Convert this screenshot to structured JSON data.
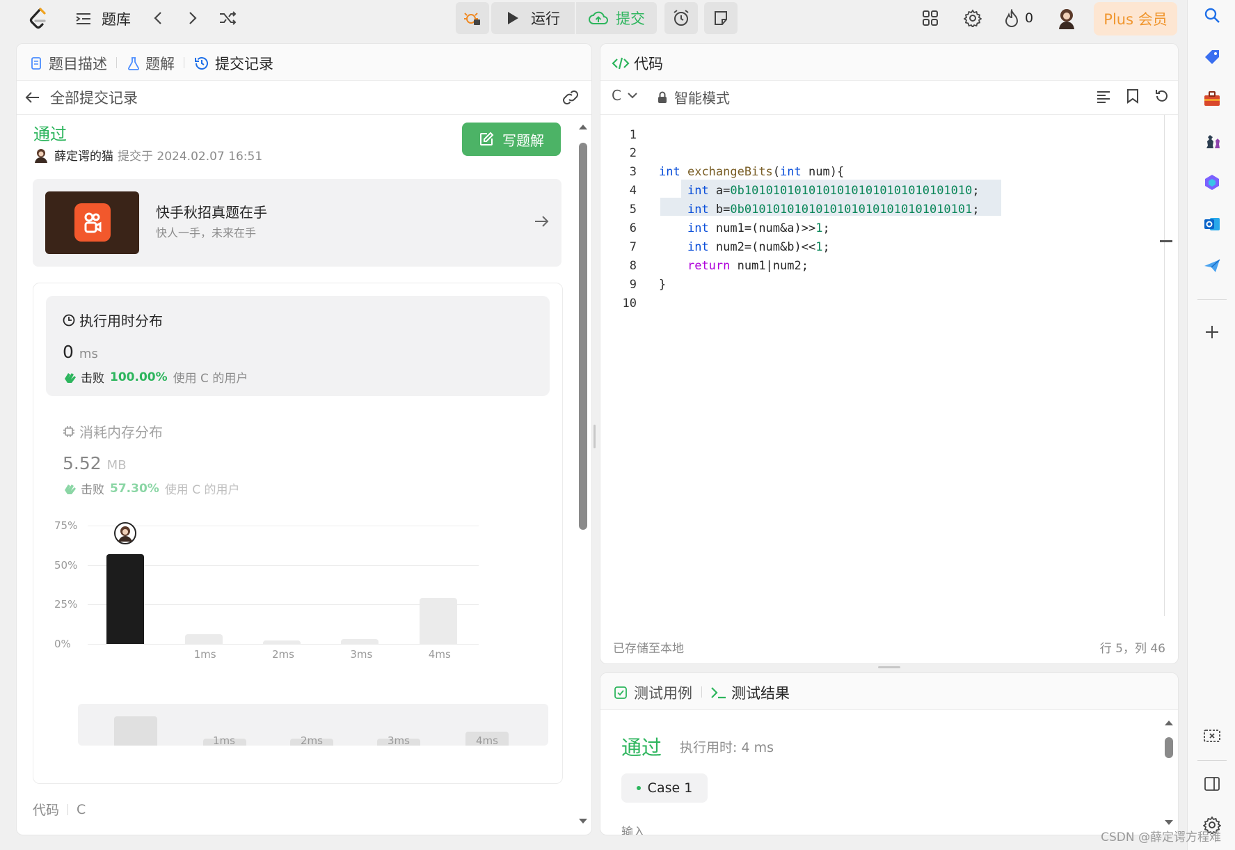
{
  "topbar": {
    "problem_bank_label": "题库",
    "run_label": "运行",
    "submit_label": "提交",
    "streak_count": "0",
    "plus_label": "Plus 会员"
  },
  "left_panel": {
    "tabs": [
      {
        "label": "题目描述"
      },
      {
        "label": "题解"
      },
      {
        "label": "提交记录"
      }
    ],
    "back_label": "全部提交记录",
    "status": "通过",
    "author": "薛定谔的猫",
    "submitted_at": "提交于 2024.02.07 16:51",
    "write_solution_label": "写题解",
    "promo": {
      "title": "快手秋招真题在手",
      "subtitle": "快人一手，未来在手"
    },
    "runtime": {
      "title": "执行用时分布",
      "value": "0",
      "unit": "ms",
      "beat_prefix": "击败",
      "beat_pct": "100.00%",
      "beat_suffix": "使用 C 的用户"
    },
    "memory": {
      "title": "消耗内存分布",
      "value": "5.52",
      "unit": "MB",
      "beat_prefix": "击败",
      "beat_pct": "57.30%",
      "beat_suffix": "使用 C 的用户"
    },
    "mini_labels": [
      "1ms",
      "2ms",
      "3ms",
      "4ms"
    ],
    "code_label": "代码",
    "code_lang": "C"
  },
  "chart_data": {
    "type": "bar",
    "categories": [
      "",
      "1ms",
      "2ms",
      "3ms",
      "4ms"
    ],
    "values": [
      57,
      6,
      2,
      3,
      29
    ],
    "ylim": [
      0,
      75
    ],
    "yticks": [
      "0%",
      "25%",
      "50%",
      "75%"
    ],
    "highlight_index": 0,
    "colors": {
      "highlight": "#1c1c1c",
      "other": "#ebebeb"
    },
    "grid": true
  },
  "editor": {
    "title": "代码",
    "language": "C",
    "mode": "智能模式",
    "line_numbers": [
      "1",
      "2",
      "3",
      "4",
      "5",
      "6",
      "7",
      "8",
      "9",
      "10"
    ],
    "saved_status": "已存储至本地",
    "cursor_pos": "行 5，列 46"
  },
  "test_panel": {
    "tab_cases": "测试用例",
    "tab_result": "测试结果",
    "status": "通过",
    "runtime": "执行用时: 4 ms",
    "case_label": "Case 1",
    "input_label": "输入"
  },
  "watermark": "CSDN @薛定谔方程难"
}
